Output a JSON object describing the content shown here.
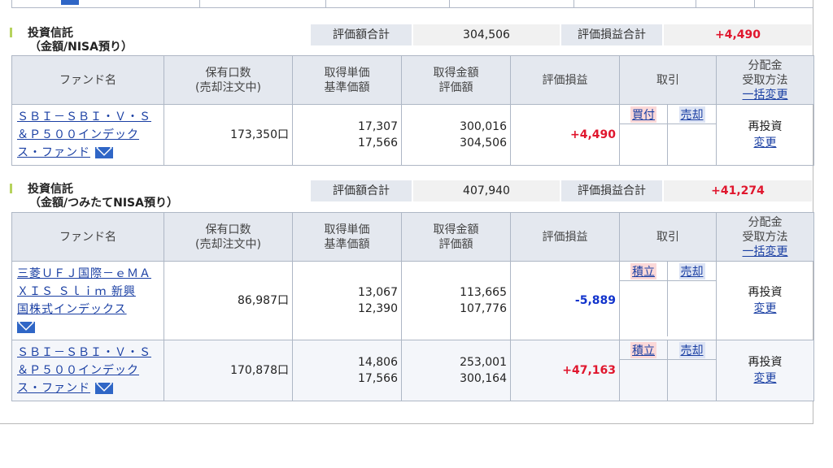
{
  "sections": [
    {
      "title_line1": "投資信託",
      "title_line2": "（金額/NISA預り）",
      "summary": {
        "eval_total_label": "評価額合計",
        "eval_total": "304,506",
        "pl_total_label": "評価損益合計",
        "pl_total": "+4,490"
      },
      "headers": {
        "fund": "ファンド名",
        "qty_1": "保有口数",
        "qty_2": "(売却注文中)",
        "price_1": "取得単価",
        "price_2": "基準価額",
        "amount_1": "取得金額",
        "amount_2": "評価額",
        "pl": "評価損益",
        "trade": "取引",
        "dist_1": "分配金",
        "dist_2": "受取方法",
        "dist_3": "一括変更"
      },
      "rows": [
        {
          "name_1": "ＳＢＩ－ＳＢＩ・Ｖ・Ｓ",
          "name_2": "＆Ｐ５００インデック",
          "name_3": "ス・ファンド",
          "qty": "173,350口",
          "unit_cost": "17,307",
          "nav": "17,566",
          "cost": "300,016",
          "value": "304,506",
          "pl": "+4,490",
          "trade_1": "買付",
          "trade_2": "売却",
          "dist": "再投資",
          "dist_link": "変更"
        }
      ]
    },
    {
      "title_line1": "投資信託",
      "title_line2": "（金額/つみたてNISA預り）",
      "summary": {
        "eval_total_label": "評価額合計",
        "eval_total": "407,940",
        "pl_total_label": "評価損益合計",
        "pl_total": "+41,274"
      },
      "headers": {
        "fund": "ファンド名",
        "qty_1": "保有口数",
        "qty_2": "(売却注文中)",
        "price_1": "取得単価",
        "price_2": "基準価額",
        "amount_1": "取得金額",
        "amount_2": "評価額",
        "pl": "評価損益",
        "trade": "取引",
        "dist_1": "分配金",
        "dist_2": "受取方法",
        "dist_3": "一括変更"
      },
      "rows": [
        {
          "name_1": "三菱ＵＦＪ国際－ｅＭＡ",
          "name_2": "ＸＩＳ Ｓｌｉｍ 新興",
          "name_3": "国株式インデックス",
          "qty": "86,987口",
          "unit_cost": "13,067",
          "nav": "12,390",
          "cost": "113,665",
          "value": "107,776",
          "pl": "-5,889",
          "trade_1": "積立",
          "trade_2": "売却",
          "dist": "再投資",
          "dist_link": "変更"
        },
        {
          "name_1": "ＳＢＩ－ＳＢＩ・Ｖ・Ｓ",
          "name_2": "＆Ｐ５００インデック",
          "name_3": "ス・ファンド",
          "qty": "170,878口",
          "unit_cost": "14,806",
          "nav": "17,566",
          "cost": "253,001",
          "value": "300,164",
          "pl": "+47,163",
          "trade_1": "積立",
          "trade_2": "売却",
          "dist": "再投資",
          "dist_link": "変更"
        }
      ]
    }
  ]
}
